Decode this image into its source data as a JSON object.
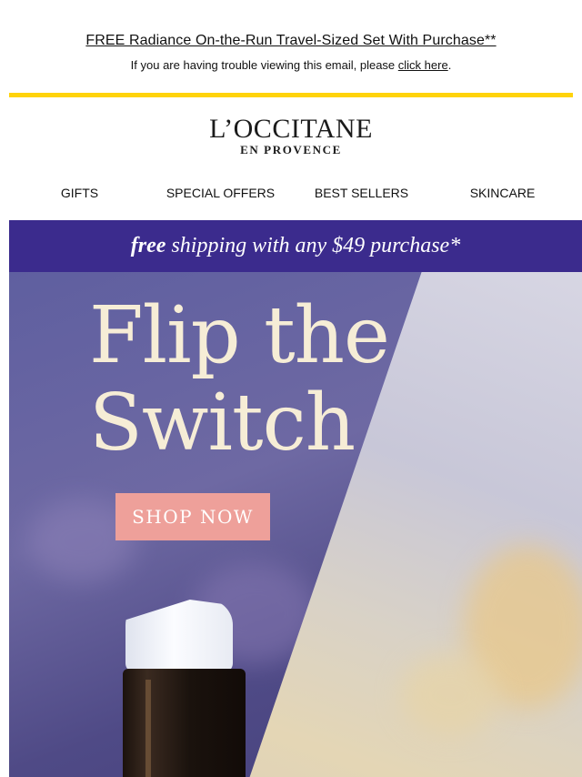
{
  "preheader": {
    "promo_text": "FREE Radiance On-the-Run Travel-Sized Set With Purchase**",
    "trouble_prefix": "If you are having trouble viewing this email, please ",
    "trouble_link": "click here",
    "trouble_suffix": "."
  },
  "brand": {
    "name": "L’OCCITANE",
    "subtitle": "EN PROVENCE",
    "accent_color": "#ffd30b"
  },
  "nav": {
    "items": [
      "GIFTS",
      "SPECIAL OFFERS",
      "BEST SELLERS",
      "SKINCARE"
    ]
  },
  "shipping_banner": {
    "bold_word": "free",
    "rest": " shipping with any $49 purchase*",
    "bg_color": "#3b2b8d"
  },
  "hero": {
    "title_line1": "Flip the",
    "title_line2": "Switch",
    "cta_label": "SHOP NOW",
    "cta_color": "#eea09a"
  }
}
